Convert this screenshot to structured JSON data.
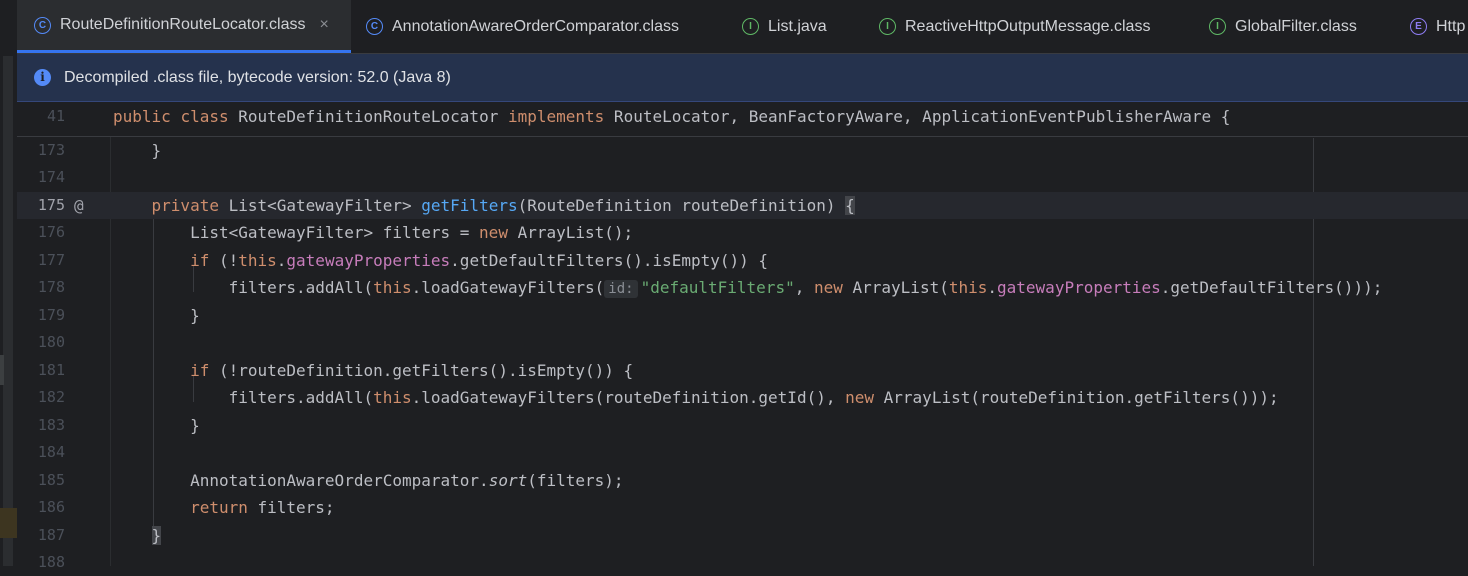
{
  "tabs": [
    {
      "label": "RouteDefinitionRouteLocator.class",
      "icon": "C",
      "kind": "class",
      "active": true
    },
    {
      "label": "AnnotationAwareOrderComparator.class",
      "icon": "C",
      "kind": "class"
    },
    {
      "label": "List.java",
      "icon": "I",
      "kind": "interface"
    },
    {
      "label": "ReactiveHttpOutputMessage.class",
      "icon": "I",
      "kind": "interface"
    },
    {
      "label": "GlobalFilter.class",
      "icon": "I",
      "kind": "interface"
    },
    {
      "label": "Http",
      "icon": "E",
      "kind": "enum"
    }
  ],
  "close_glyph": "×",
  "banner": {
    "text": "Decompiled .class file, bytecode version: 52.0 (Java 8)",
    "icon": "i"
  },
  "sticky": {
    "line_number": "41"
  },
  "lines": [
    {
      "n": "173"
    },
    {
      "n": "174"
    },
    {
      "n": "175",
      "marker": "@"
    },
    {
      "n": "176"
    },
    {
      "n": "177"
    },
    {
      "n": "178"
    },
    {
      "n": "179"
    },
    {
      "n": "180"
    },
    {
      "n": "181"
    },
    {
      "n": "182"
    },
    {
      "n": "183"
    },
    {
      "n": "184"
    },
    {
      "n": "185"
    },
    {
      "n": "186"
    },
    {
      "n": "187"
    },
    {
      "n": "188"
    }
  ],
  "tokens": {
    "public": "public",
    "class": "class",
    "private": "private",
    "new": "new",
    "if": "if",
    "this": "this",
    "return": "return",
    "implements": "implements",
    "sticky_name": " RouteDefinitionRouteLocator ",
    "sticky_tail": " RouteLocator, BeanFactoryAware, ApplicationEventPublisherAware {",
    "brace_close": "}",
    "l175_a": " List<GatewayFilter> ",
    "l175_fn": "getFilters",
    "l175_b": "(RouteDefinition routeDefinition) ",
    "l175_brace": "{",
    "l176_a": "List<GatewayFilter> filters = ",
    "l176_b": " ArrayList();",
    "l177_a": " (!",
    "l177_dot": ".",
    "l177_fld": "gatewayProperties",
    "l177_b": ".getDefaultFilters().isEmpty()) {",
    "l178_a": "filters.addAll(",
    "l178_b": ".loadGatewayFilters(",
    "l178_hint": "id:",
    "l178_str": "\"defaultFilters\"",
    "l178_c": ", ",
    "l178_d": " ArrayList(",
    "l178_e": ".",
    "l178_fld": "gatewayProperties",
    "l178_f": ".getDefaultFilters()));",
    "l181_a": " (!routeDefinition.getFilters().isEmpty()) {",
    "l182_a": "filters.addAll(",
    "l182_b": ".loadGatewayFilters(routeDefinition.getId(), ",
    "l182_c": " ArrayList(routeDefinition.getFilters()));",
    "l185_a": "AnnotationAwareOrderComparator.",
    "l185_sort": "sort",
    "l185_b": "(filters);",
    "l186_b": " filters;"
  }
}
